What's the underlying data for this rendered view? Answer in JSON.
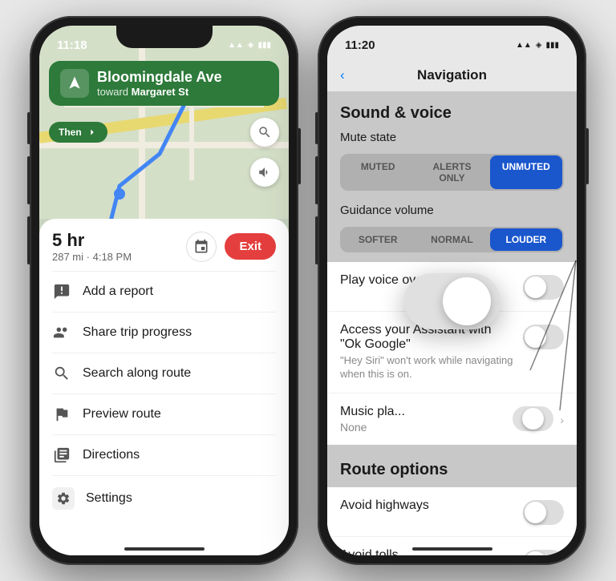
{
  "phone1": {
    "status": {
      "time": "11:18",
      "signal": "●●●",
      "wifi": "▲",
      "battery": "■"
    },
    "nav": {
      "street": "Bloomingdale Ave",
      "toward_label": "toward",
      "toward_street": "Margaret St",
      "then_label": "Then"
    },
    "trip": {
      "duration": "5 hr",
      "distance": "287 mi",
      "eta": "4:18 PM",
      "exit_label": "Exit"
    },
    "menu_items": [
      {
        "icon": "report-icon",
        "label": "Add a report"
      },
      {
        "icon": "share-icon",
        "label": "Share trip progress"
      },
      {
        "icon": "search-icon",
        "label": "Search along route"
      },
      {
        "icon": "preview-icon",
        "label": "Preview route"
      },
      {
        "icon": "directions-icon",
        "label": "Directions"
      }
    ],
    "settings": {
      "icon": "gear-icon",
      "label": "Settings"
    }
  },
  "phone2": {
    "status": {
      "time": "11:20",
      "signal": "●●●",
      "wifi": "▲",
      "battery": "■"
    },
    "header": {
      "back_label": "‹",
      "title": "Navigation"
    },
    "sound_voice": {
      "section_title": "Sound & voice",
      "mute_label": "Mute state",
      "mute_options": [
        "MUTED",
        "ALERTS ONLY",
        "UNMUTED"
      ],
      "mute_active": "UNMUTED",
      "guidance_label": "Guidance volume",
      "guidance_options": [
        "SOFTER",
        "NORMAL",
        "LOUDER"
      ],
      "guidance_active": "LOUDER"
    },
    "settings_rows": [
      {
        "title": "Play voice over Bluetooth",
        "subtitle": "",
        "toggle": "off",
        "type": "toggle"
      },
      {
        "title": "Access your Assistant with \"Ok Google\"",
        "subtitle": "\"Hey Siri\" won't work while navigating when this is on.",
        "toggle": "off",
        "type": "toggle"
      },
      {
        "title": "Music pla...",
        "subtitle": "None",
        "toggle": "mid",
        "type": "toggle-chevron"
      }
    ],
    "route_options": {
      "section_title": "Route options",
      "rows": [
        {
          "title": "Avoid highways",
          "toggle": "off"
        },
        {
          "title": "Avoid tolls",
          "toggle": "off"
        }
      ]
    }
  }
}
